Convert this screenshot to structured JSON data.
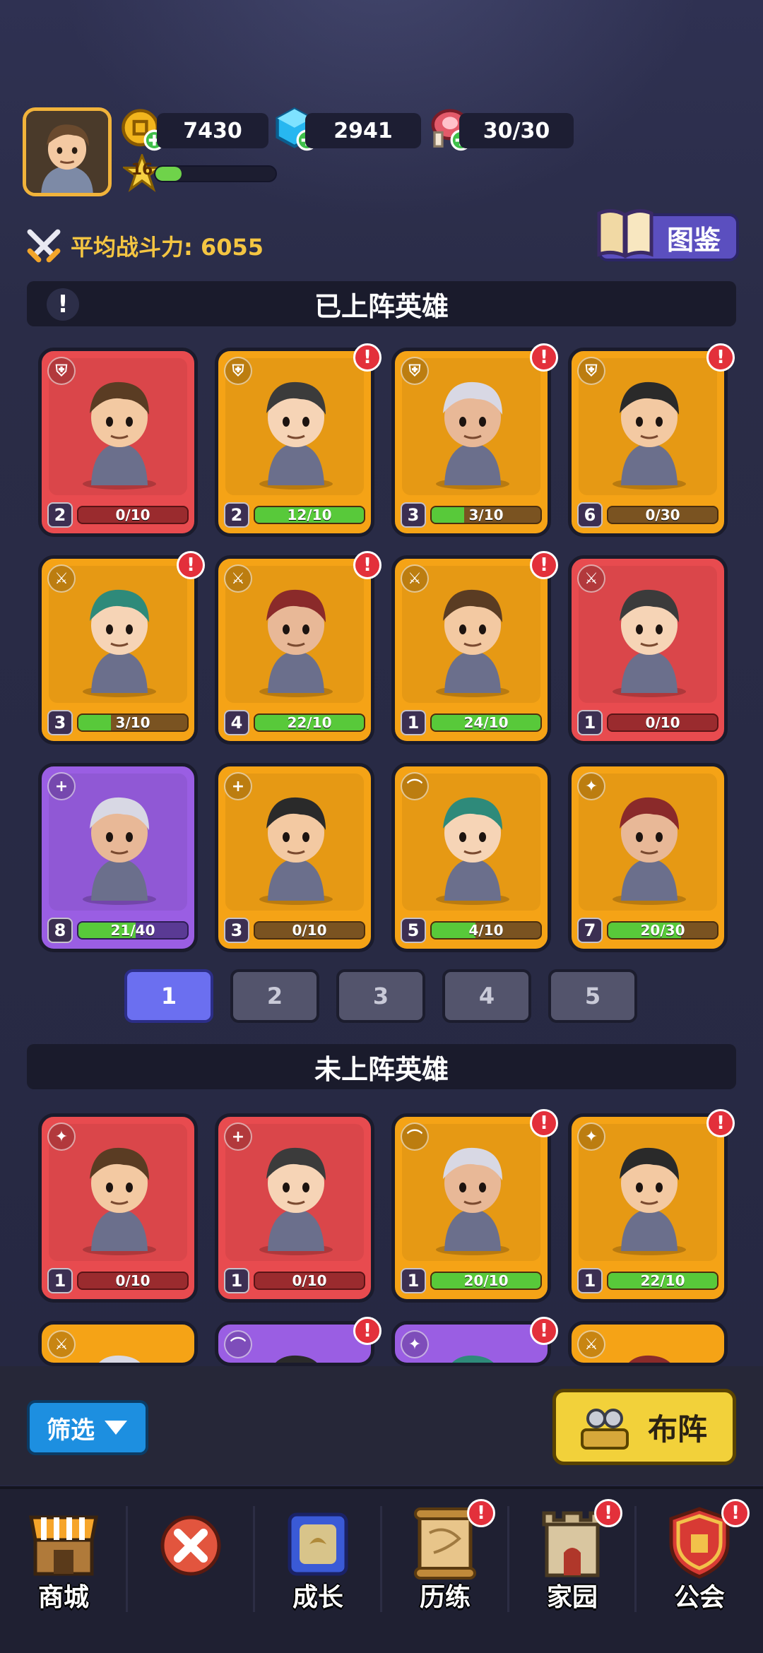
{
  "header": {
    "resources": {
      "gold": "7430",
      "gems": "2941",
      "stamina": "30/30"
    },
    "level": "16",
    "xp_fraction": 0.22,
    "power_label": "平均战斗力: 6055",
    "atlas_label": "图鉴"
  },
  "deployed": {
    "title": "已上阵英雄",
    "heroes": [
      {
        "rarity": "red",
        "class": "shield-icon",
        "stars": "2",
        "progress": "0/10",
        "fraction": 0.0,
        "alert": false
      },
      {
        "rarity": "orange",
        "class": "shield-icon",
        "stars": "2",
        "progress": "12/10",
        "fraction": 1.0,
        "alert": true
      },
      {
        "rarity": "orange",
        "class": "shield-icon",
        "stars": "3",
        "progress": "3/10",
        "fraction": 0.3,
        "alert": true
      },
      {
        "rarity": "orange",
        "class": "shield-icon",
        "stars": "6",
        "progress": "0/30",
        "fraction": 0.0,
        "alert": true
      },
      {
        "rarity": "orange",
        "class": "sword-icon",
        "stars": "3",
        "progress": "3/10",
        "fraction": 0.3,
        "alert": true
      },
      {
        "rarity": "orange",
        "class": "sword-icon",
        "stars": "4",
        "progress": "22/10",
        "fraction": 1.0,
        "alert": true
      },
      {
        "rarity": "orange",
        "class": "sword-icon",
        "stars": "1",
        "progress": "24/10",
        "fraction": 1.0,
        "alert": true
      },
      {
        "rarity": "red",
        "class": "sword-icon",
        "stars": "1",
        "progress": "0/10",
        "fraction": 0.0,
        "alert": false
      },
      {
        "rarity": "purple",
        "class": "plus-icon",
        "stars": "8",
        "progress": "21/40",
        "fraction": 0.525,
        "alert": false
      },
      {
        "rarity": "orange",
        "class": "plus-icon",
        "stars": "3",
        "progress": "0/10",
        "fraction": 0.0,
        "alert": false
      },
      {
        "rarity": "orange",
        "class": "bow-icon",
        "stars": "5",
        "progress": "4/10",
        "fraction": 0.4,
        "alert": false
      },
      {
        "rarity": "orange",
        "class": "magic-icon",
        "stars": "7",
        "progress": "20/30",
        "fraction": 0.667,
        "alert": false
      }
    ]
  },
  "pager": {
    "pages": [
      "1",
      "2",
      "3",
      "4",
      "5"
    ],
    "active": 0
  },
  "undeployed": {
    "title": "未上阵英雄",
    "heroes": [
      {
        "rarity": "red",
        "class": "magic-icon",
        "stars": "1",
        "progress": "0/10",
        "fraction": 0.0,
        "alert": false
      },
      {
        "rarity": "red",
        "class": "plus-icon",
        "stars": "1",
        "progress": "0/10",
        "fraction": 0.0,
        "alert": false
      },
      {
        "rarity": "orange",
        "class": "bow-icon",
        "stars": "1",
        "progress": "20/10",
        "fraction": 1.0,
        "alert": true
      },
      {
        "rarity": "orange",
        "class": "magic-icon",
        "stars": "1",
        "progress": "22/10",
        "fraction": 1.0,
        "alert": true
      }
    ]
  },
  "actions": {
    "filter_label": "筛选",
    "deploy_label": "布阵"
  },
  "nav": {
    "items": [
      {
        "label": "商城",
        "icon": "shop-icon",
        "alert": false
      },
      {
        "label": "",
        "icon": "close-icon",
        "alert": false
      },
      {
        "label": "成长",
        "icon": "growth-icon",
        "alert": false
      },
      {
        "label": "历练",
        "icon": "scroll-icon",
        "alert": true
      },
      {
        "label": "家园",
        "icon": "castle-icon",
        "alert": true
      },
      {
        "label": "公会",
        "icon": "guild-icon",
        "alert": true
      }
    ]
  },
  "colors": {
    "orange": "#f5a316",
    "red": "#e84b4f",
    "purple": "#9a5ee3",
    "accent": "#6b6ff0"
  }
}
